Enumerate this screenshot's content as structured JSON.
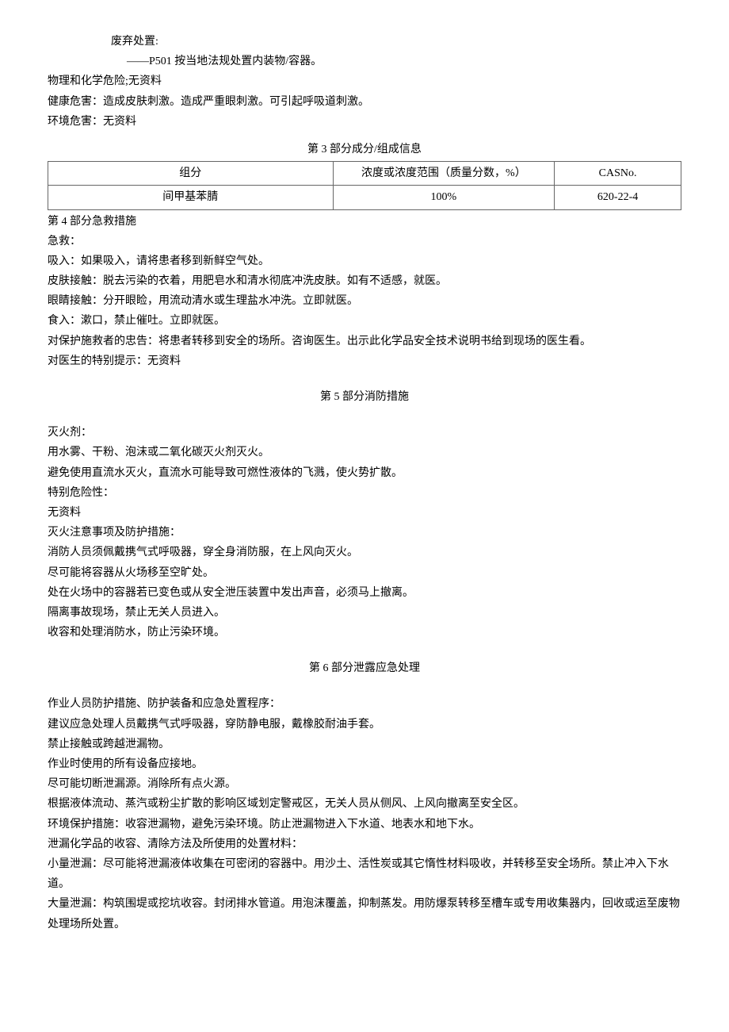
{
  "disposal": {
    "label": "废弃处置:",
    "p501": "——P501 按当地法规处置内装物/容器。"
  },
  "hazards": {
    "physical": "物理和化学危险;无资料",
    "health": "健康危害：造成皮肤刺激。造成严重眼刺激。可引起呼吸道刺激。",
    "environment": "环境危害：无资料"
  },
  "section3": {
    "title": "第 3 部分成分/组成信息",
    "headers": {
      "component": "组分",
      "concentration": "浓度或浓度范围（质量分数，%）",
      "cas": "CASNo."
    },
    "rows": [
      {
        "component": "间甲基苯腈",
        "concentration": "100%",
        "cas": "620-22-4"
      }
    ]
  },
  "section4": {
    "title": "第 4 部分急救措施",
    "firstaid_label": "急救：",
    "inhalation": "吸入：如果吸入，请将患者移到新鲜空气处。",
    "skin": "皮肤接触：脱去污染的衣着，用肥皂水和清水彻底冲洗皮肤。如有不适感，就医。",
    "eye": "眼睛接触：分开眼睑，用流动清水或生理盐水冲洗。立即就医。",
    "ingestion": "食入：漱口，禁止催吐。立即就医。",
    "rescuer": "对保护施救者的忠告：将患者转移到安全的场所。咨询医生。出示此化学品安全技术说明书给到现场的医生看。",
    "doctor": "对医生的特别提示：无资料"
  },
  "section5": {
    "title": "第 5 部分消防措施",
    "extinguisher_label": "灭火剂：",
    "line1": "用水雾、干粉、泡沫或二氧化碳灭火剂灭火。",
    "line2": "避免使用直流水灭火，直流水可能导致可燃性液体的飞溅，使火势扩散。",
    "special_label": "特别危险性：",
    "special_value": "无资料",
    "notes_label": "灭火注意事项及防护措施：",
    "note1": "消防人员须佩戴携气式呼吸器，穿全身消防服，在上风向灭火。",
    "note2": "尽可能将容器从火场移至空旷处。",
    "note3": "处在火场中的容器若已变色或从安全泄压装置中发出声音，必须马上撤离。",
    "note4": "隔离事故现场，禁止无关人员进入。",
    "note5": "收容和处理消防水，防止污染环境。"
  },
  "section6": {
    "title": "第 6 部分泄露应急处理",
    "personnel_label": "作业人员防护措施、防护装备和应急处置程序：",
    "line1": "建议应急处理人员戴携气式呼吸器，穿防静电服，戴橡胶耐油手套。",
    "line2": "禁止接触或跨越泄漏物。",
    "line3": "作业时使用的所有设备应接地。",
    "line4": "尽可能切断泄漏源。消除所有点火源。",
    "line5": "根据液体流动、蒸汽或粉尘扩散的影响区域划定警戒区，无关人员从侧风、上风向撤离至安全区。",
    "env": "环境保护措施：收容泄漏物，避免污染环境。防止泄漏物进入下水道、地表水和地下水。",
    "cleanup_label": "泄漏化学品的收容、清除方法及所使用的处置材料：",
    "small": "小量泄漏：尽可能将泄漏液体收集在可密闭的容器中。用沙土、活性炭或其它惰性材料吸收，并转移至安全场所。禁止冲入下水道。",
    "large": "大量泄漏：构筑围堤或挖坑收容。封闭排水管道。用泡沫覆盖，抑制蒸发。用防爆泵转移至槽车或专用收集器内，回收或运至废物处理场所处置。"
  }
}
